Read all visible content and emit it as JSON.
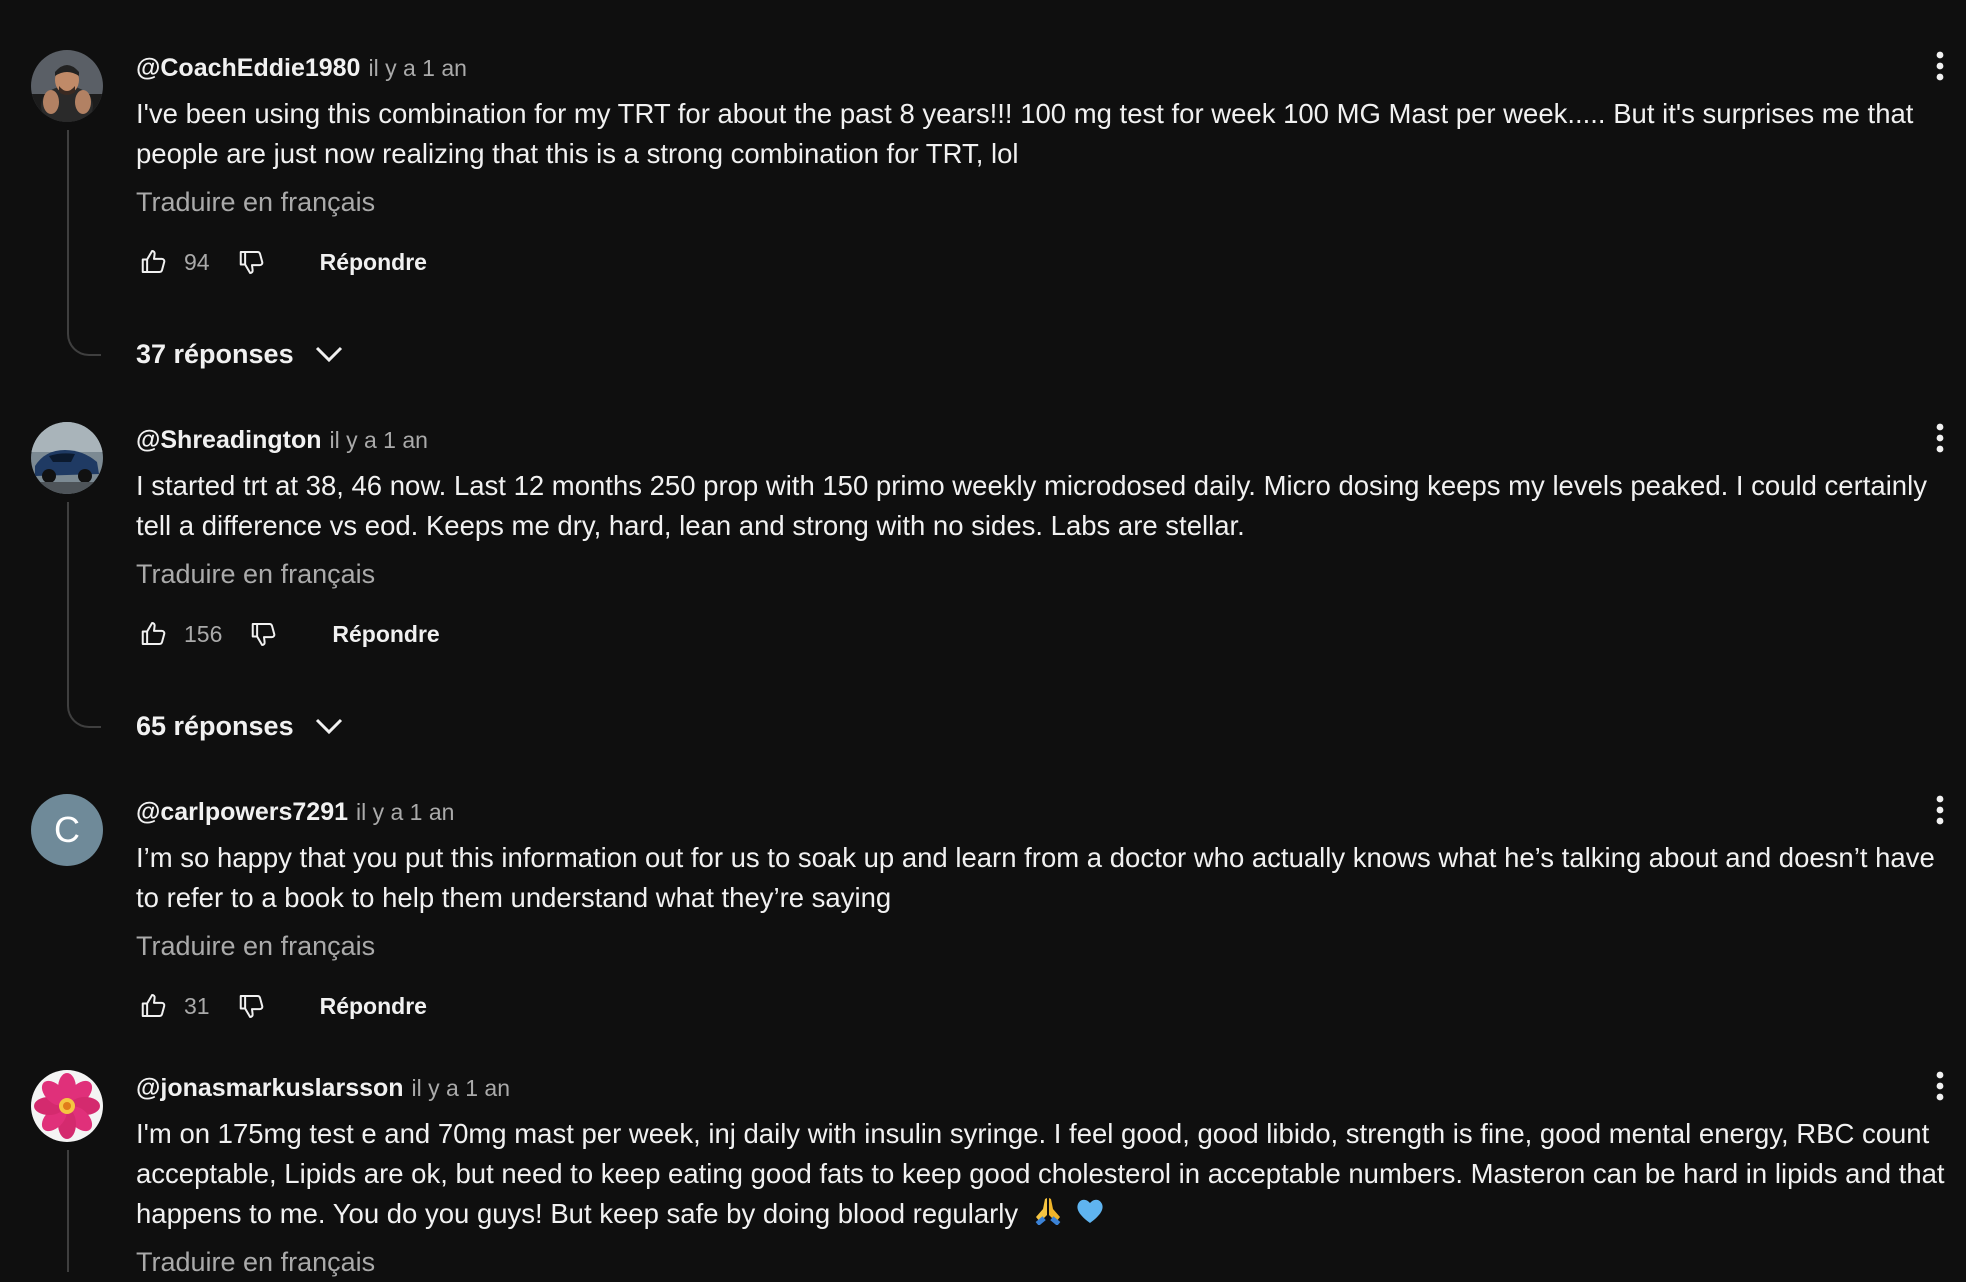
{
  "comments": [
    {
      "author": "@CoachEddie1980",
      "time": "il y a 1 an",
      "text_lines": [
        "I've been using this combination for my TRT for about the past 8 years!!! 100 mg test for week 100 MG Mast per week..... But it's surprises me that",
        "people are just now realizing that this is a strong combination for TRT, lol"
      ],
      "translate": "Traduire en français",
      "likes": "94",
      "reply": "Répondre",
      "replies": "37 réponses",
      "avatar": "photo-man-icon"
    },
    {
      "author": "@Shreadington",
      "time": "il y a 1 an",
      "text_lines": [
        "I started trt at 38, 46 now. Last 12 months 250 prop with 150 primo weekly microdosed daily. Micro dosing keeps my levels peaked. I could certainly",
        "tell a difference vs eod. Keeps me dry, hard, lean and strong with no sides. Labs are stellar."
      ],
      "translate": "Traduire en français",
      "likes": "156",
      "reply": "Répondre",
      "replies": "65 réponses",
      "avatar": "photo-car-icon"
    },
    {
      "author": "@carlpowers7291",
      "time": "il y a 1 an",
      "text_lines": [
        "I’m so happy that you put this information out for us to soak up and learn from a doctor who actually knows what he’s talking about and doesn’t have",
        "to refer to a book to help them understand what they’re saying"
      ],
      "translate": "Traduire en français",
      "likes": "31",
      "reply": "Répondre",
      "avatar_letter": "C",
      "avatar_color": "#6f8a99"
    },
    {
      "author": "@jonasmarkuslarsson",
      "time": "il y a 1 an",
      "text_lines": [
        "I'm on 175mg test e and 70mg mast per week, inj daily with insulin syringe. I feel good, good libido, strength is fine, good mental energy, RBC count",
        "acceptable, Lipids are ok, but need to keep eating good fats to keep good cholesterol in acceptable numbers. Masteron can be hard in lipids and that",
        "happens to me. You do you guys! But keep safe by doing blood regularly"
      ],
      "emojis": [
        "folded-hands-icon",
        "blue-heart-icon"
      ],
      "translate": "Traduire en français",
      "avatar": "photo-flower-icon"
    }
  ],
  "colors": {
    "background": "#0f0f0f",
    "text": "#f1f1f1",
    "secondary": "#aaaaaa",
    "thread": "#3f3f3f"
  }
}
